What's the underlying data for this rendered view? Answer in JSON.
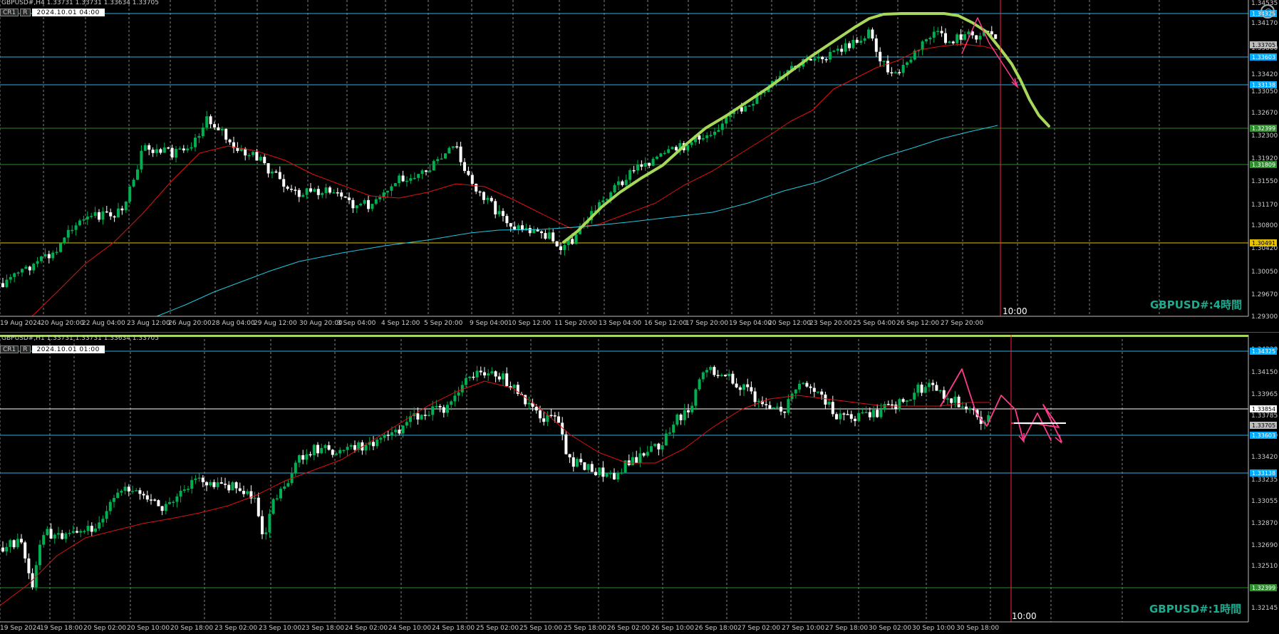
{
  "top_pane": {
    "header": "GBPUSD#,H4  1.33731 1.33731 1.33634 1.33705",
    "tag_mode": "CR1",
    "tag_r": "R",
    "tag_date": "2024.10.01 04:00",
    "timeframe_label": "GBPUSD#:4時間",
    "vline_label": "10:00",
    "price_labels": [
      "1.34535",
      "1.34170",
      "1.33800",
      "1.33420",
      "1.33050",
      "1.32670",
      "1.32300",
      "1.31920",
      "1.31550",
      "1.31170",
      "1.30800",
      "1.30420",
      "1.30050",
      "1.29670",
      "1.29300"
    ],
    "price_tags": [
      {
        "text": "1.34325",
        "color": "#00aaff"
      },
      {
        "text": "1.33705",
        "color": "#bdbdbd"
      },
      {
        "text": "1.33603",
        "color": "#00aaff"
      },
      {
        "text": "1.33138",
        "color": "#00aaff"
      },
      {
        "text": "1.32399",
        "color": "#2f8f2f"
      },
      {
        "text": "1.31809",
        "color": "#2f8f2f"
      },
      {
        "text": "1.30491",
        "color": "#e6c200"
      }
    ],
    "time_labels": [
      "19 Aug 2024",
      "20 Aug 20:00",
      "22 Aug 04:00",
      "23 Aug 12:00",
      "26 Aug 20:00",
      "28 Aug 04:00",
      "29 Aug 12:00",
      "30 Aug 20:00",
      "3 Sep 04:00",
      "4 Sep 12:00",
      "5 Sep 20:00",
      "9 Sep 04:00",
      "10 Sep 12:00",
      "11 Sep 20:00",
      "13 Sep 04:00",
      "16 Sep 12:00",
      "17 Sep 20:00",
      "19 Sep 04:00",
      "20 Sep 12:00",
      "23 Sep 20:00",
      "25 Sep 04:00",
      "26 Sep 12:00",
      "27 Sep 20:00"
    ]
  },
  "bottom_pane": {
    "header": "GBPUSD#,H1  1.33731 1.33731 1.33634 1.33705",
    "tag_mode": "CR1",
    "tag_r": "R",
    "tag_date": "2024.10.01 01:00",
    "timeframe_label": "GBPUSD#:1時間",
    "vline_label": "10:00",
    "price_labels": [
      "1.34330",
      "1.34150",
      "1.33965",
      "1.33785",
      "1.33600",
      "1.33420",
      "1.33235",
      "1.33055",
      "1.32870",
      "1.32690",
      "1.32510",
      "1.32325",
      "1.32145"
    ],
    "price_tags": [
      {
        "text": "1.34325",
        "color": "#00aaff"
      },
      {
        "text": "1.33854",
        "color": "#ffffff"
      },
      {
        "text": "1.33705",
        "color": "#bdbdbd"
      },
      {
        "text": "1.33603",
        "color": "#00aaff"
      },
      {
        "text": "1.33138",
        "color": "#00aaff"
      },
      {
        "text": "1.32399",
        "color": "#2f8f2f"
      }
    ],
    "time_labels": [
      "19 Sep 2024",
      "19 Sep 18:00",
      "20 Sep 02:00",
      "20 Sep 10:00",
      "20 Sep 18:00",
      "23 Sep 02:00",
      "23 Sep 10:00",
      "23 Sep 18:00",
      "24 Sep 02:00",
      "24 Sep 10:00",
      "24 Sep 18:00",
      "25 Sep 02:00",
      "25 Sep 10:00",
      "25 Sep 18:00",
      "26 Sep 02:00",
      "26 Sep 10:00",
      "26 Sep 18:00",
      "27 Sep 02:00",
      "27 Sep 10:00",
      "27 Sep 18:00",
      "30 Sep 02:00",
      "30 Sep 10:00",
      "30 Sep 18:00"
    ]
  },
  "colors": {
    "bull_candle": "#00b050",
    "bear_candle": "#ffffff",
    "ma_fast": "#e01010",
    "ma_slow": "#1fc8e0",
    "trend_curve": "#a8d85a",
    "forecast": "#ff3c8c",
    "vline": "#ff2040",
    "hline_blue": "#2ab0e0",
    "hline_green": "#2a8a2a",
    "hline_yellow": "#e6c200",
    "grid": "#bbbbbb",
    "axis_text": "#cccccc"
  }
}
